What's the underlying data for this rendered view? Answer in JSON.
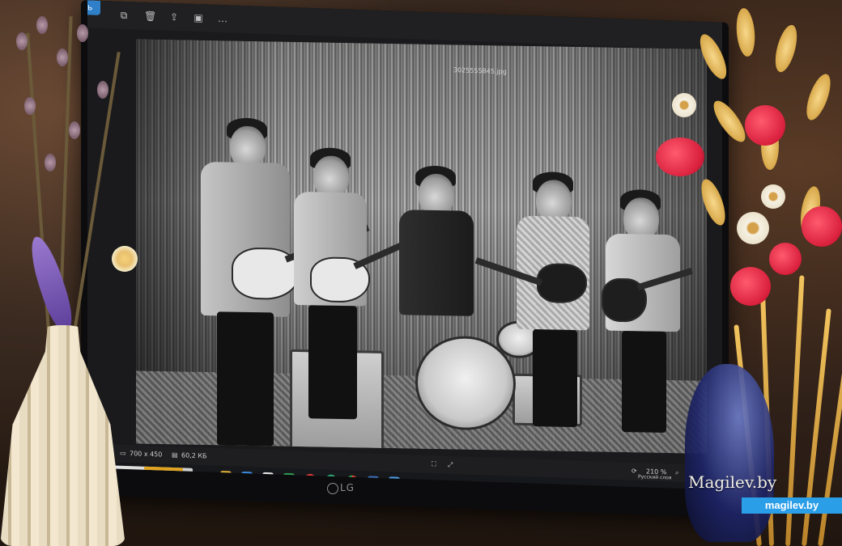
{
  "viewer": {
    "edit_label": "Изменить",
    "filename": "3025555845.jpg",
    "resolution": "700 x 450",
    "file_size": "60,2 КБ",
    "zoom": "210 %",
    "layout_label": "Русский слоя"
  },
  "monitor": {
    "brand": "LG"
  },
  "watermark": {
    "text": "Magilev.by",
    "badge": "magilev.by",
    "badge_color": "#2b9ee8"
  },
  "icons": {
    "toolbar": [
      "copy-icon",
      "delete-icon",
      "share-icon",
      "slideshow-icon",
      "more-icon"
    ],
    "taskbar": [
      "explorer-icon",
      "photos-icon",
      "calendar-icon",
      "maps-icon",
      "opera-icon",
      "edge-icon",
      "chrome-icon",
      "terminal-icon",
      "viewer-icon"
    ]
  }
}
